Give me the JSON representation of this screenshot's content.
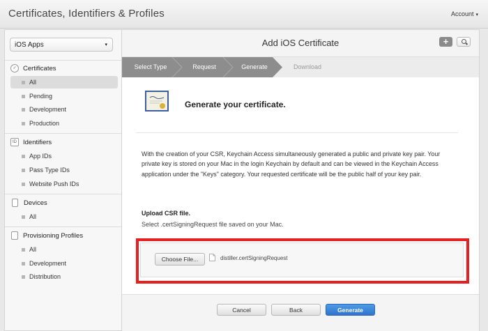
{
  "header": {
    "app_title": "Certificates, Identifiers & Profiles",
    "account_label": "Account",
    "account_caret": "▾"
  },
  "sidebar": {
    "app_select": {
      "value": "iOS Apps",
      "caret": "▾"
    },
    "sections": [
      {
        "title": "Certificates",
        "icon": "certificate-icon",
        "items": [
          "All",
          "Pending",
          "Development",
          "Production"
        ],
        "active": "All"
      },
      {
        "title": "Identifiers",
        "icon": "id-icon",
        "icon_text": "ID",
        "items": [
          "App IDs",
          "Pass Type IDs",
          "Website Push IDs"
        ]
      },
      {
        "title": "Devices",
        "icon": "device-icon",
        "items": [
          "All"
        ]
      },
      {
        "title": "Provisioning Profiles",
        "icon": "profile-icon",
        "items": [
          "All",
          "Development",
          "Distribution"
        ]
      }
    ]
  },
  "main": {
    "title": "Add iOS Certificate",
    "plus_label": "+",
    "steps": [
      {
        "label": "Select Type",
        "state": "done"
      },
      {
        "label": "Request",
        "state": "done"
      },
      {
        "label": "Generate",
        "state": "current"
      },
      {
        "label": "Download",
        "state": "upcoming"
      }
    ],
    "generate_title": "Generate your certificate.",
    "description": "With the creation of your CSR, Keychain Access simultaneously generated a public and private key pair. Your private key is stored on your Mac in the login Keychain by default and can be viewed in the Keychain Access application under the \"Keys\" category. Your requested certificate will be the public half of your key pair.",
    "upload_title": "Upload CSR file.",
    "upload_subtitle": "Select .certSigningRequest file saved on your Mac.",
    "choose_file_label": "Choose File...",
    "file_name": "distiller.certSigningRequest"
  },
  "footer": {
    "cancel_label": "Cancel",
    "back_label": "Back",
    "generate_label": "Generate"
  },
  "colors": {
    "highlight_border": "#e62020",
    "primary_button": "#2e74cc",
    "step_active": "#8d8d8d"
  }
}
